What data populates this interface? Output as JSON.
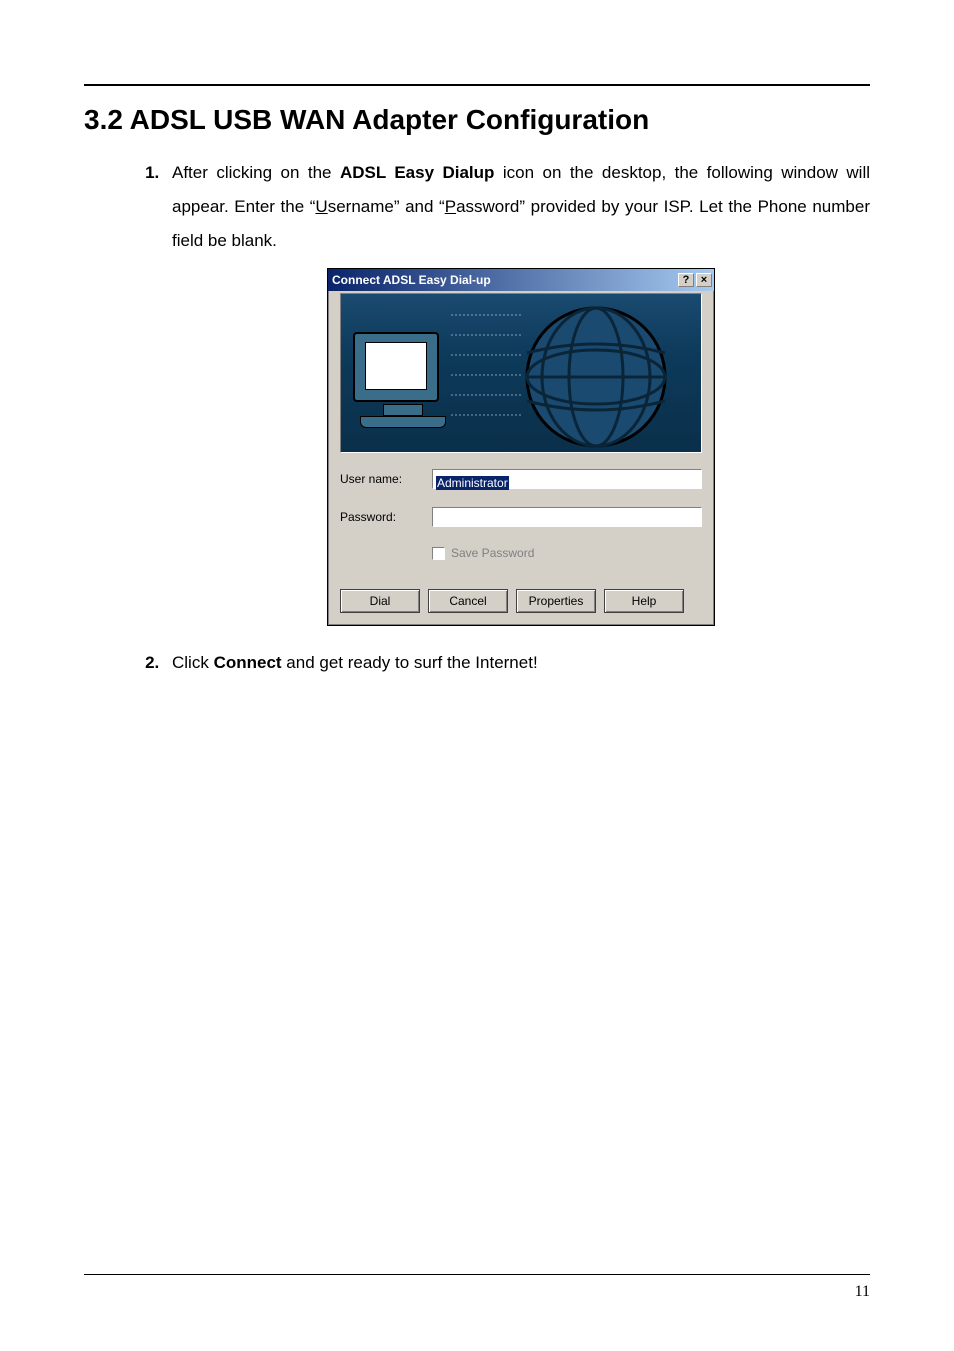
{
  "section": {
    "title": "3.2 ADSL USB WAN Adapter Configuration"
  },
  "step1": {
    "pre": "After clicking on the ",
    "bold": "ADSL Easy Dialup",
    "post1": " icon on the desktop, the following window will appear. Enter the “",
    "u1": "U",
    "mid1": "sername” and “",
    "u2": "P",
    "mid2": "assword” provided by your ISP. Let the Phone number field be blank."
  },
  "step2": {
    "pre": "Click ",
    "bold": "Connect",
    "post": " and get ready to surf the Internet!"
  },
  "dialog": {
    "title": "Connect ADSL Easy Dial-up",
    "help_btn": "?",
    "close_btn": "×",
    "username_label": "User name:",
    "username_value": "Administrator",
    "password_label": "Password:",
    "password_value": "",
    "save_password_label": "Save Password",
    "buttons": {
      "dial": "Dial",
      "cancel": "Cancel",
      "properties": "Properties",
      "help": "Help"
    }
  },
  "page_number": "11"
}
